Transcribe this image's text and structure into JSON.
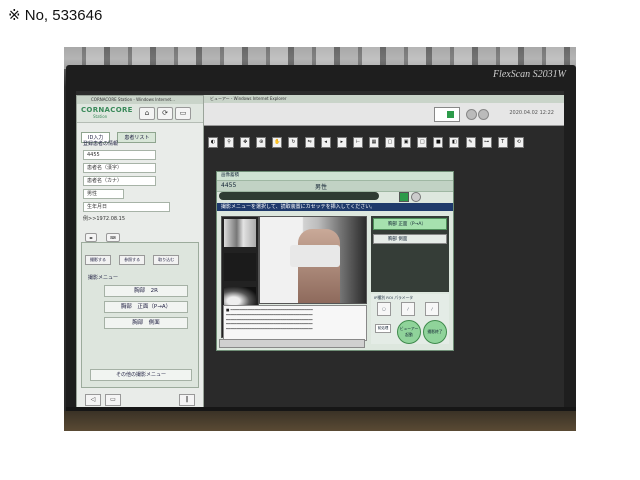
{
  "caption": "※ No, 533646",
  "monitor": {
    "brand": "FlexScan S2031W"
  },
  "station": {
    "titlebar": "CORNACORE Station - Windows Internet...",
    "logo": "CORNACORE",
    "logo_sub": "Station",
    "tabs": [
      "ID入力",
      "患者リスト"
    ],
    "form_title": "登録患者の情報",
    "patient_id": "4455",
    "name_kanji_placeholder": "患者名（漢字）",
    "name_kana_placeholder": "患者名（カナ）",
    "sex_value": "男性",
    "birthdate_placeholder": "生年月日",
    "birthdate_hint": "例>>1972.08.15",
    "menu_tabs": [
      "撮影する",
      "参照する",
      "取り込む"
    ],
    "menu_title": "撮影メニュー",
    "menu_items": [
      "胸部　2R",
      "胸部　正面（P→A）",
      "胸部　側面"
    ],
    "other_menu": "その他の撮影メニュー"
  },
  "viewer": {
    "title": "ビューアー - Windows Internet Explorer",
    "datetime": "2020.04.02 12:22",
    "dialog": {
      "title": "画像蓄積",
      "patient_id": "4455",
      "sex": "男性",
      "instruction": "撮影メニューを選択して、読取装置にカセッテを挿入してください。",
      "menu_items": [
        "胸部 正面（P→A）",
        "胸部 側面"
      ],
      "button_tabs": [
        "IP種別",
        "ROI",
        "パラメータ"
      ],
      "buttons": [
        "前処理",
        "ビューアー起動",
        "撮影終了"
      ]
    }
  },
  "colors": {
    "accent_green": "#2d9b4a",
    "instruction_blue": "#1f3a6b"
  }
}
